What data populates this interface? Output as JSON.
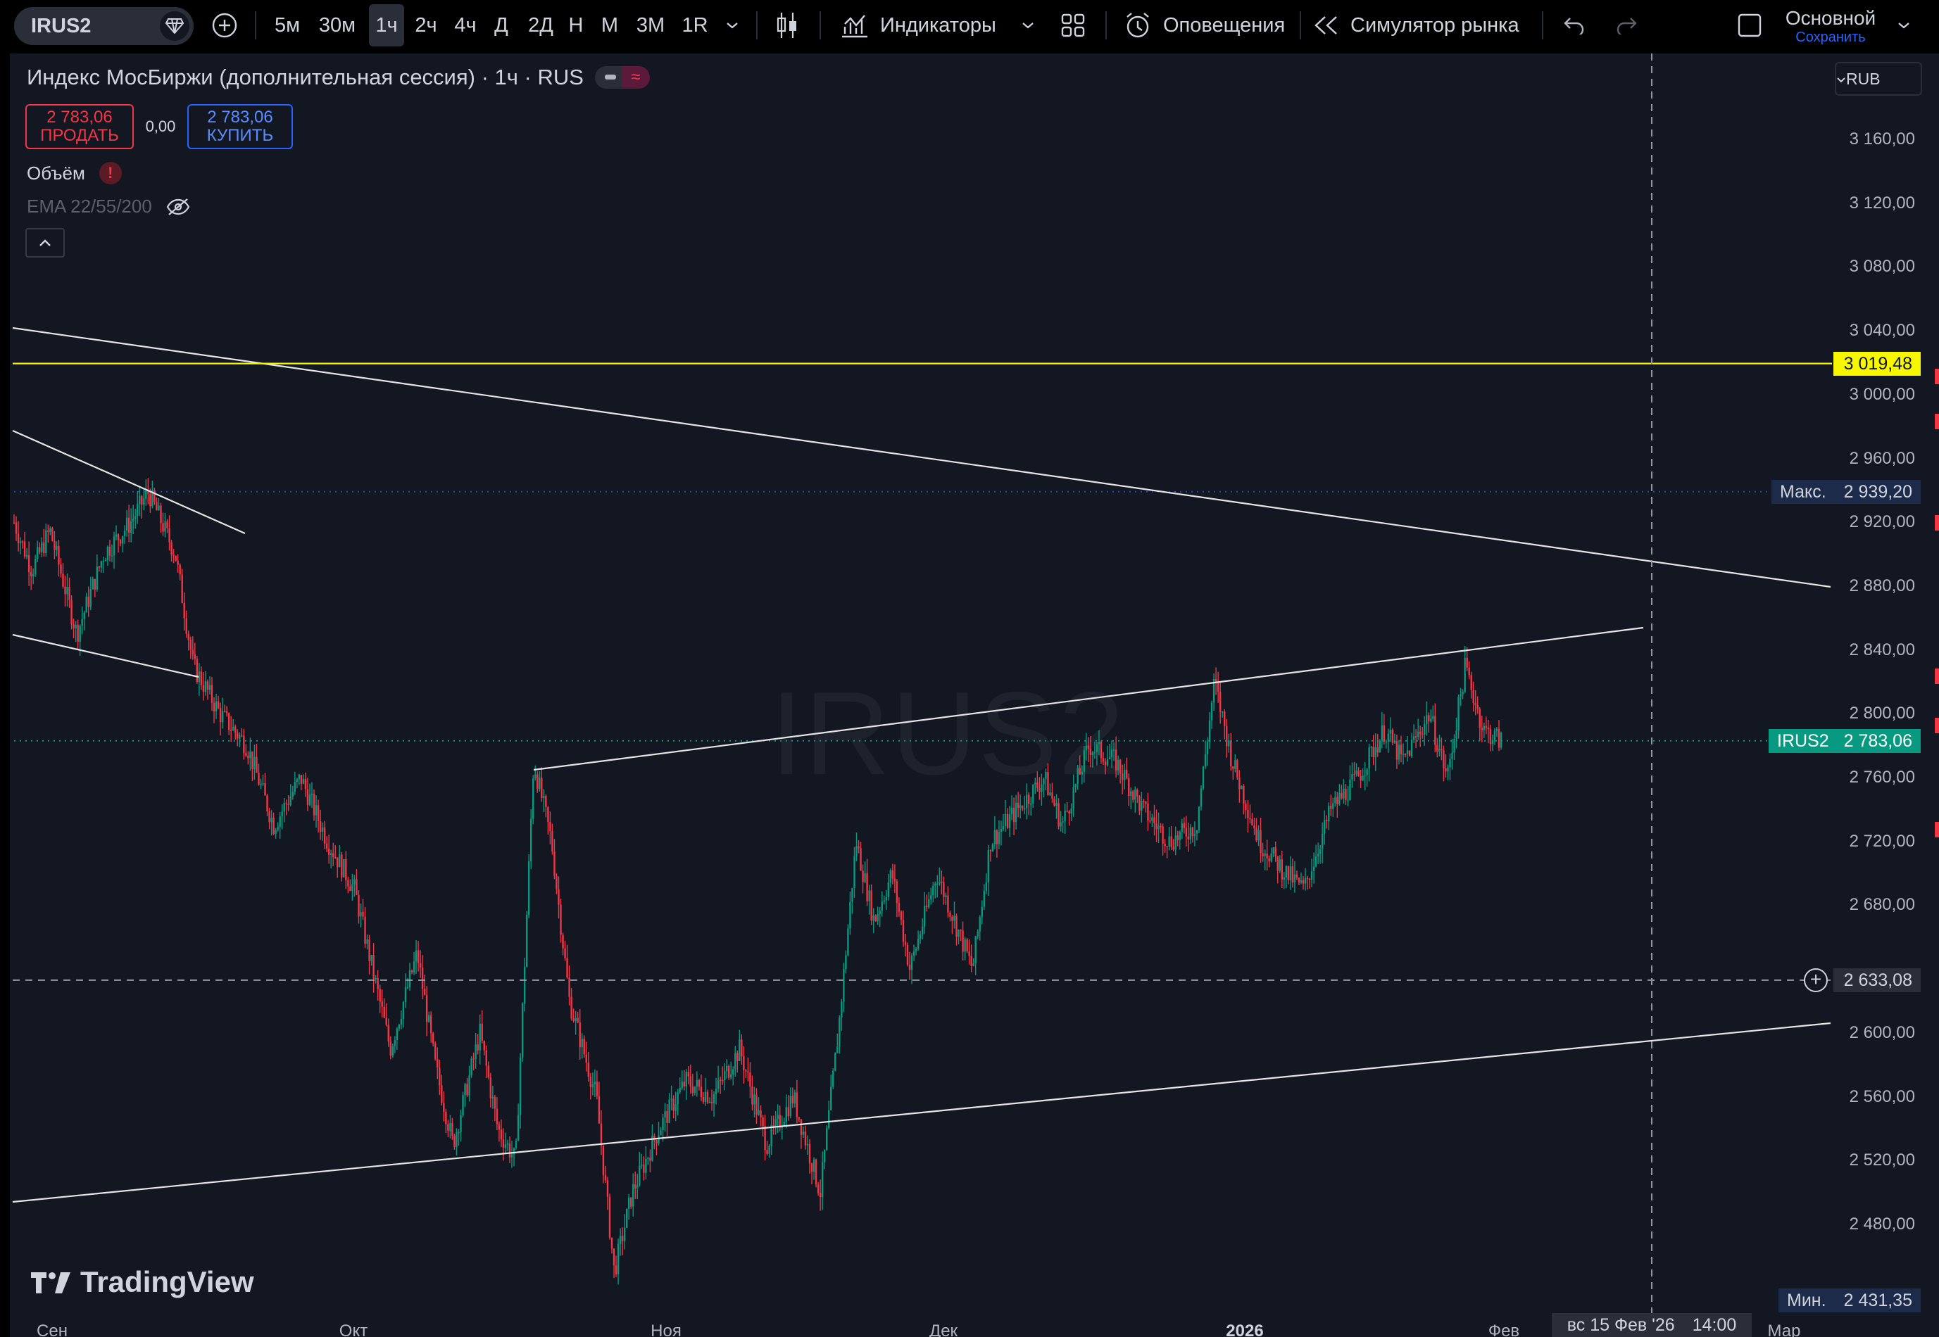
{
  "toolbar": {
    "symbol": "IRUS2",
    "timeframes": [
      "5м",
      "30м",
      "1ч",
      "2ч",
      "4ч",
      "Д",
      "2Д",
      "Н",
      "М",
      "3М",
      "1R"
    ],
    "active_timeframe": "1ч",
    "indicators_label": "Индикаторы",
    "alerts_label": "Оповещения",
    "replay_label": "Симулятор рынка",
    "layout_name": "Основной",
    "save_label": "Сохранить"
  },
  "legend": {
    "title": "Индекс МосБиржи (дополнительная сессия) · 1ч · RUS",
    "sell_price": "2 783,06",
    "sell_label": "ПРОДАТЬ",
    "spread": "0,00",
    "buy_price": "2 783,06",
    "buy_label": "КУПИТЬ",
    "indicator_volume": "Объём",
    "indicator_ema": "EMA 22/55/200"
  },
  "watermark": "IRUS2",
  "logo_text": "TradingView",
  "currency": "RUB",
  "colors": {
    "up": "#089981",
    "down": "#f23645",
    "accent": "#2962ff",
    "alert_line": "#f7f700",
    "bg": "#131722"
  },
  "chart_data": {
    "type": "candlestick",
    "symbol": "IRUS2",
    "interval": "1ч",
    "y_ticks": [
      "3 160,00",
      "3 120,00",
      "3 080,00",
      "3 040,00",
      "3 000,00",
      "2 960,00",
      "2 920,00",
      "2 880,00",
      "2 840,00",
      "2 800,00",
      "2 760,00",
      "2 720,00",
      "2 680,00",
      "2 600,00",
      "2 560,00",
      "2 520,00",
      "2 480,00"
    ],
    "ylim": [
      2431.35,
      3175
    ],
    "x_ticks": [
      "Сен",
      "Окт",
      "Ноя",
      "Дек",
      "2026",
      "Фев",
      "Мар"
    ],
    "last_price": {
      "label": "IRUS2",
      "value": "2 783,06"
    },
    "high": {
      "label": "Макс.",
      "value": "2 939,20"
    },
    "low": {
      "label": "Мин.",
      "value": "2 431,35"
    },
    "alert_level": "3 019,48",
    "crosshair": {
      "price": "2 633,08",
      "date": "вс 15 Фев '26",
      "time": "14:00"
    },
    "price_path": [
      [
        0.0,
        2920
      ],
      [
        0.01,
        2890
      ],
      [
        0.02,
        2915
      ],
      [
        0.035,
        2850
      ],
      [
        0.05,
        2900
      ],
      [
        0.065,
        2920
      ],
      [
        0.075,
        2939
      ],
      [
        0.09,
        2900
      ],
      [
        0.1,
        2830
      ],
      [
        0.115,
        2800
      ],
      [
        0.13,
        2780
      ],
      [
        0.145,
        2730
      ],
      [
        0.16,
        2760
      ],
      [
        0.175,
        2720
      ],
      [
        0.19,
        2690
      ],
      [
        0.2,
        2640
      ],
      [
        0.21,
        2590
      ],
      [
        0.225,
        2650
      ],
      [
        0.235,
        2580
      ],
      [
        0.245,
        2530
      ],
      [
        0.26,
        2600
      ],
      [
        0.27,
        2540
      ],
      [
        0.28,
        2520
      ],
      [
        0.29,
        2770
      ],
      [
        0.3,
        2720
      ],
      [
        0.31,
        2620
      ],
      [
        0.325,
        2560
      ],
      [
        0.335,
        2450
      ],
      [
        0.345,
        2500
      ],
      [
        0.36,
        2540
      ],
      [
        0.375,
        2570
      ],
      [
        0.39,
        2560
      ],
      [
        0.405,
        2590
      ],
      [
        0.42,
        2530
      ],
      [
        0.435,
        2560
      ],
      [
        0.45,
        2500
      ],
      [
        0.46,
        2600
      ],
      [
        0.47,
        2720
      ],
      [
        0.48,
        2670
      ],
      [
        0.49,
        2700
      ],
      [
        0.5,
        2640
      ],
      [
        0.515,
        2700
      ],
      [
        0.525,
        2670
      ],
      [
        0.535,
        2640
      ],
      [
        0.545,
        2720
      ],
      [
        0.56,
        2740
      ],
      [
        0.575,
        2760
      ],
      [
        0.585,
        2730
      ],
      [
        0.6,
        2780
      ],
      [
        0.615,
        2770
      ],
      [
        0.63,
        2740
      ],
      [
        0.645,
        2720
      ],
      [
        0.66,
        2730
      ],
      [
        0.67,
        2820
      ],
      [
        0.68,
        2770
      ],
      [
        0.695,
        2720
      ],
      [
        0.71,
        2700
      ],
      [
        0.72,
        2690
      ],
      [
        0.735,
        2740
      ],
      [
        0.75,
        2760
      ],
      [
        0.765,
        2790
      ],
      [
        0.775,
        2770
      ],
      [
        0.79,
        2800
      ],
      [
        0.8,
        2760
      ],
      [
        0.81,
        2830
      ],
      [
        0.82,
        2790
      ],
      [
        0.83,
        2783
      ]
    ],
    "trendlines": "5 drawn white trendlines and 1 yellow horizontal alert line"
  }
}
